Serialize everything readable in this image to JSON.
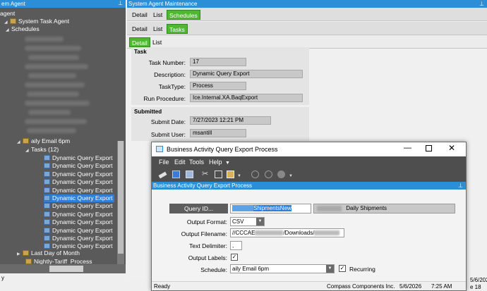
{
  "left_panel": {
    "title": "em Agent",
    "pin_icon": "⊥",
    "root": "agent",
    "system_task_agent": "System Task Agent",
    "schedules": "Schedules",
    "daily_email": "aily Email 6pm",
    "tasks_label": "Tasks (12)",
    "task_items": [
      "Dynamic Query Export",
      "Dynamic Query Export",
      "Dynamic Query Export",
      "Dynamic Query Export",
      "Dynamic Query Export",
      "Dynamic Query Export",
      "Dynamic Query Export",
      "Dynamic Query Export",
      "Dynamic Query Export",
      "Dynamic Query Export",
      "Dynamic Query Export",
      "Dynamic Query Export"
    ],
    "last_day": "Last Day of Month",
    "nightly": "Nightly-Tariff_Process",
    "status": "y"
  },
  "right_panel": {
    "title": "System Agent Maintenance",
    "tabs_row1": [
      "Detail",
      "List",
      "Schedules"
    ],
    "tabs_row2": [
      "Detail",
      "List",
      "Tasks"
    ],
    "tabs_row3": [
      "Detail",
      "List"
    ],
    "task_group": "Task",
    "task_number_label": "Task Number:",
    "task_number": "17",
    "description_label": "Description:",
    "description": "Dynamic Query Export",
    "tasktype_label": "TaskType:",
    "tasktype": "Process",
    "run_procedure_label": "Run Procedure:",
    "run_procedure": "Ice.Internal.XA.BaqExport",
    "submitted_group": "Submitted",
    "submit_date_label": "Submit Date:",
    "submit_date": "7/27/2023 12:21 PM",
    "submit_user_label": "Submit User:",
    "submit_user": "msantill",
    "status_date": "5/6/202",
    "status_ext": "e 18"
  },
  "dialog": {
    "title": "Business Activity Query Export Process",
    "menu": [
      "File",
      "Edit",
      "Tools",
      "Help"
    ],
    "strip_title": "Business Activity Query Export Process",
    "query_id_button": "Query ID...",
    "query_id_value": "ShipmentsNew",
    "query_desc": "Daily Shipments",
    "output_format_label": "Output Format:",
    "output_format": "CSV",
    "output_filename_label": "Output Filename:",
    "output_filename": "//CCCAE",
    "output_filename_part": "/Downloads/",
    "text_delimiter_label": "Text Delimiter:",
    "text_delimiter": ",",
    "output_labels_label": "Output Labels:",
    "output_labels_checked": true,
    "schedule_label": "Schedule:",
    "schedule": "aily Email 6pm",
    "recurring_label": "Recurring",
    "recurring_checked": true,
    "status_ready": "Ready",
    "status_company": "Compass Components Inc.",
    "status_date": "5/6/2026",
    "status_time": "7:25 AM",
    "colors": {
      "accent": "#2a8fd6",
      "green_tab": "#4fb82e",
      "menubar": "#4e4e4e"
    }
  }
}
